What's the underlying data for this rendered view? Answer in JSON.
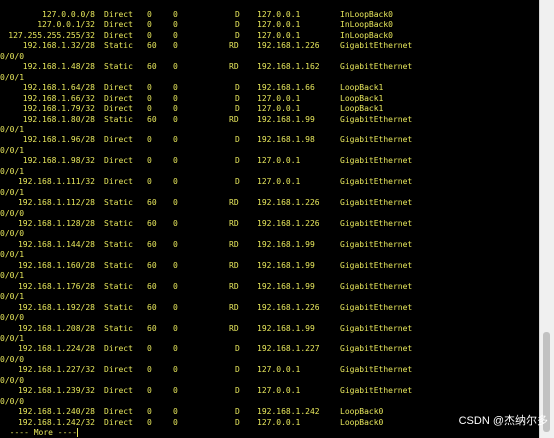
{
  "routes": [
    {
      "dest": "127.0.0.0/8",
      "proto": "Direct",
      "pre": "0",
      "cost": "0",
      "flags": "D",
      "nexthop": "127.0.0.1",
      "iface": "InLoopBack0",
      "wrap": ""
    },
    {
      "dest": "127.0.0.1/32",
      "proto": "Direct",
      "pre": "0",
      "cost": "0",
      "flags": "D",
      "nexthop": "127.0.0.1",
      "iface": "InLoopBack0",
      "wrap": ""
    },
    {
      "dest": "127.255.255.255/32",
      "proto": "Direct",
      "pre": "0",
      "cost": "0",
      "flags": "D",
      "nexthop": "127.0.0.1",
      "iface": "InLoopBack0",
      "wrap": ""
    },
    {
      "dest": "192.168.1.32/28",
      "proto": "Static",
      "pre": "60",
      "cost": "0",
      "flags": "RD",
      "nexthop": "192.168.1.226",
      "iface": "GigabitEthernet",
      "wrap": "0/0/0"
    },
    {
      "dest": "192.168.1.48/28",
      "proto": "Static",
      "pre": "60",
      "cost": "0",
      "flags": "RD",
      "nexthop": "192.168.1.162",
      "iface": "GigabitEthernet",
      "wrap": "0/0/1"
    },
    {
      "dest": "192.168.1.64/28",
      "proto": "Direct",
      "pre": "0",
      "cost": "0",
      "flags": "D",
      "nexthop": "192.168.1.66",
      "iface": "LoopBack1",
      "wrap": ""
    },
    {
      "dest": "192.168.1.66/32",
      "proto": "Direct",
      "pre": "0",
      "cost": "0",
      "flags": "D",
      "nexthop": "127.0.0.1",
      "iface": "LoopBack1",
      "wrap": ""
    },
    {
      "dest": "192.168.1.79/32",
      "proto": "Direct",
      "pre": "0",
      "cost": "0",
      "flags": "D",
      "nexthop": "127.0.0.1",
      "iface": "LoopBack1",
      "wrap": ""
    },
    {
      "dest": "192.168.1.80/28",
      "proto": "Static",
      "pre": "60",
      "cost": "0",
      "flags": "RD",
      "nexthop": "192.168.1.99",
      "iface": "GigabitEthernet",
      "wrap": "0/0/1"
    },
    {
      "dest": "192.168.1.96/28",
      "proto": "Direct",
      "pre": "0",
      "cost": "0",
      "flags": "D",
      "nexthop": "192.168.1.98",
      "iface": "GigabitEthernet",
      "wrap": "0/0/1"
    },
    {
      "dest": "192.168.1.98/32",
      "proto": "Direct",
      "pre": "0",
      "cost": "0",
      "flags": "D",
      "nexthop": "127.0.0.1",
      "iface": "GigabitEthernet",
      "wrap": "0/0/1"
    },
    {
      "dest": "192.168.1.111/32",
      "proto": "Direct",
      "pre": "0",
      "cost": "0",
      "flags": "D",
      "nexthop": "127.0.0.1",
      "iface": "GigabitEthernet",
      "wrap": "0/0/1"
    },
    {
      "dest": "192.168.1.112/28",
      "proto": "Static",
      "pre": "60",
      "cost": "0",
      "flags": "RD",
      "nexthop": "192.168.1.226",
      "iface": "GigabitEthernet",
      "wrap": "0/0/0"
    },
    {
      "dest": "192.168.1.128/28",
      "proto": "Static",
      "pre": "60",
      "cost": "0",
      "flags": "RD",
      "nexthop": "192.168.1.226",
      "iface": "GigabitEthernet",
      "wrap": "0/0/0"
    },
    {
      "dest": "192.168.1.144/28",
      "proto": "Static",
      "pre": "60",
      "cost": "0",
      "flags": "RD",
      "nexthop": "192.168.1.99",
      "iface": "GigabitEthernet",
      "wrap": "0/0/1"
    },
    {
      "dest": "192.168.1.160/28",
      "proto": "Static",
      "pre": "60",
      "cost": "0",
      "flags": "RD",
      "nexthop": "192.168.1.99",
      "iface": "GigabitEthernet",
      "wrap": "0/0/1"
    },
    {
      "dest": "192.168.1.176/28",
      "proto": "Static",
      "pre": "60",
      "cost": "0",
      "flags": "RD",
      "nexthop": "192.168.1.99",
      "iface": "GigabitEthernet",
      "wrap": "0/0/1"
    },
    {
      "dest": "192.168.1.192/28",
      "proto": "Static",
      "pre": "60",
      "cost": "0",
      "flags": "RD",
      "nexthop": "192.168.1.226",
      "iface": "GigabitEthernet",
      "wrap": "0/0/0"
    },
    {
      "dest": "192.168.1.208/28",
      "proto": "Static",
      "pre": "60",
      "cost": "0",
      "flags": "RD",
      "nexthop": "192.168.1.99",
      "iface": "GigabitEthernet",
      "wrap": "0/0/1"
    },
    {
      "dest": "192.168.1.224/28",
      "proto": "Direct",
      "pre": "0",
      "cost": "0",
      "flags": "D",
      "nexthop": "192.168.1.227",
      "iface": "GigabitEthernet",
      "wrap": "0/0/0"
    },
    {
      "dest": "192.168.1.227/32",
      "proto": "Direct",
      "pre": "0",
      "cost": "0",
      "flags": "D",
      "nexthop": "127.0.0.1",
      "iface": "GigabitEthernet",
      "wrap": "0/0/0"
    },
    {
      "dest": "192.168.1.239/32",
      "proto": "Direct",
      "pre": "0",
      "cost": "0",
      "flags": "D",
      "nexthop": "127.0.0.1",
      "iface": "GigabitEthernet",
      "wrap": "0/0/0"
    },
    {
      "dest": "192.168.1.240/28",
      "proto": "Direct",
      "pre": "0",
      "cost": "0",
      "flags": "D",
      "nexthop": "192.168.1.242",
      "iface": "LoopBack0",
      "wrap": ""
    },
    {
      "dest": "192.168.1.242/32",
      "proto": "Direct",
      "pre": "0",
      "cost": "0",
      "flags": "D",
      "nexthop": "127.0.0.1",
      "iface": "LoopBack0",
      "wrap": ""
    }
  ],
  "more_prompt": "---- More ----",
  "watermark": "CSDN @杰纳尔多",
  "colors": {
    "background": "#000000",
    "text": "#e8e85c",
    "scrollbar": "#f0f0f0",
    "watermark": "#ffffff"
  }
}
